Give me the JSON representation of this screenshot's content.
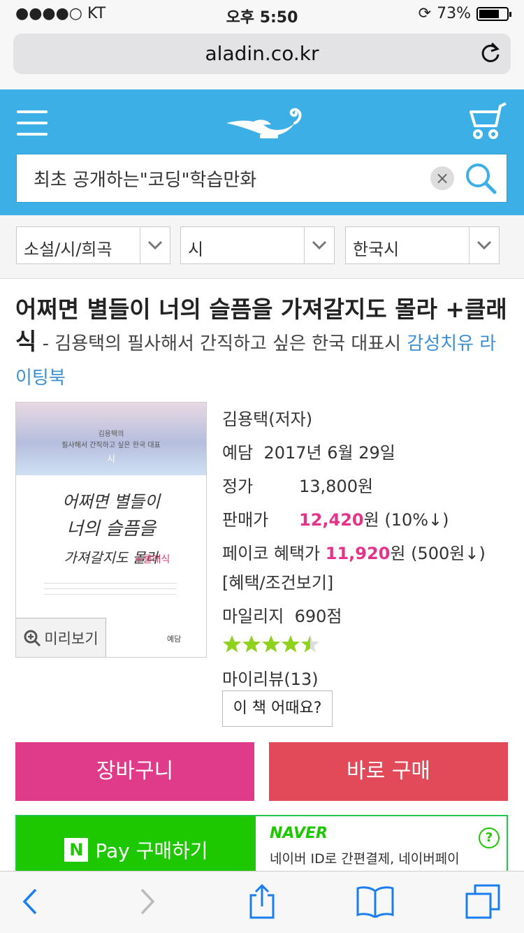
{
  "status": {
    "carrier": "●●●●○ KT",
    "time": "오후 5:50",
    "battery": "73%"
  },
  "browser": {
    "url": "aladin.co.kr"
  },
  "search": {
    "query": "최초 공개하는\"코딩\"학습만화"
  },
  "categories": [
    {
      "label": "소설/시/희곡"
    },
    {
      "label": "시"
    },
    {
      "label": "한국시"
    }
  ],
  "book": {
    "title": "어쩌면 별들이 너의 슬픔을 가져갈지도 몰라 +클래식",
    "subtitle": " - 김용택의 필사해서 간직하고 싶은 한국 대표시 ",
    "tag": "감성치유 라이팅북",
    "author": "김용택(저자)",
    "publisher": "예담",
    "pubdate": "2017년 6월 29일",
    "list_price_label": "정가",
    "list_price": "13,800원",
    "sale_price_label": "판매가",
    "sale_price": "12,420",
    "sale_suffix": "원 (10%↓)",
    "payco_label": "페이코 혜택가",
    "payco_price": "11,920",
    "payco_suffix": "원 (500원↓)",
    "benefit_link": "[혜택/조건보기]",
    "mileage_label": "마일리지",
    "mileage": "690점",
    "rating": 4.5,
    "review_count": "마이리뷰(13)",
    "review_button": "이 책 어때요?"
  },
  "cover": {
    "top_line": "김용택의",
    "sub_line": "필사해서 간직하고 싶은 한국 대표",
    "sub_line2": "시",
    "hand_line1": "어쩌면 별들이",
    "hand_line2": "너의 슬픔을",
    "hand_line3": "가져갈지도 몰라",
    "hand_accent": "+클래식",
    "publisher_mark": "예담",
    "preview": "미리보기"
  },
  "buttons": {
    "cart": "장바구니",
    "buy": "바로 구매",
    "npay_label": "Pay 구매하기",
    "npay_badge": "N",
    "naver": "NAVER",
    "naver_desc": "네이버 ID로 간편결제, 네이버페이",
    "help": "?"
  },
  "colors": {
    "header": "#3cb0e6",
    "pink": "#e6338a",
    "cart": "#e03a8a",
    "buy": "#e24a5a",
    "naver": "#1ec800",
    "star": "#8ed21d"
  }
}
